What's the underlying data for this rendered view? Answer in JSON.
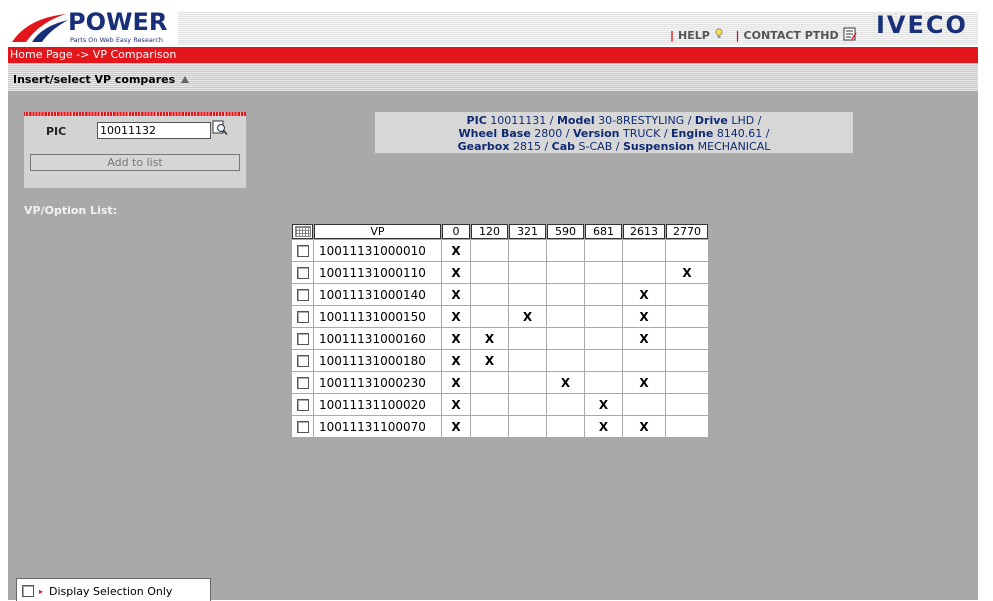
{
  "header": {
    "brand": "POWER",
    "tagline": "Parts On Web Easy Research",
    "help_label": "HELP",
    "contact_label": "CONTACT PTHD",
    "partner_logo": "IVECO",
    "accent_red": "#e3161c",
    "brand_blue": "#1a2f7a"
  },
  "breadcrumb": "Home Page -> VP Comparison",
  "section_title": "Insert/select VP compares",
  "pic_form": {
    "label": "PIC",
    "value": "10011132",
    "search_icon": "search-doc-icon",
    "add_button": "Add to list"
  },
  "info": {
    "pic_label": "PIC",
    "pic": "10011131",
    "model_label": "Model",
    "model": "30-8RESTYLING",
    "drive_label": "Drive",
    "drive": "LHD",
    "wheelbase_label": "Wheel Base",
    "wheelbase": "2800",
    "version_label": "Version",
    "version": "TRUCK",
    "engine_label": "Engine",
    "engine": "8140.61",
    "gearbox_label": "Gearbox",
    "gearbox": "2815",
    "cab_label": "Cab",
    "cab": "S-CAB",
    "suspension_label": "Suspension",
    "suspension": "MECHANICAL"
  },
  "vp_list_label": "VP/Option List:",
  "table": {
    "header_vp": "VP",
    "columns": [
      "0",
      "120",
      "321",
      "590",
      "681",
      "2613",
      "2770"
    ],
    "mark": "X",
    "rows": [
      {
        "vp": "10011131000010",
        "marks": [
          "X",
          "",
          "",
          "",
          "",
          "",
          ""
        ]
      },
      {
        "vp": "10011131000110",
        "marks": [
          "X",
          "",
          "",
          "",
          "",
          "",
          "X"
        ]
      },
      {
        "vp": "10011131000140",
        "marks": [
          "X",
          "",
          "",
          "",
          "",
          "X",
          ""
        ]
      },
      {
        "vp": "10011131000150",
        "marks": [
          "X",
          "",
          "X",
          "",
          "",
          "X",
          ""
        ]
      },
      {
        "vp": "10011131000160",
        "marks": [
          "X",
          "X",
          "",
          "",
          "",
          "X",
          ""
        ]
      },
      {
        "vp": "10011131000180",
        "marks": [
          "X",
          "X",
          "",
          "",
          "",
          "",
          ""
        ]
      },
      {
        "vp": "10011131000230",
        "marks": [
          "X",
          "",
          "",
          "X",
          "",
          "X",
          ""
        ]
      },
      {
        "vp": "10011131100020",
        "marks": [
          "X",
          "",
          "",
          "",
          "X",
          "",
          ""
        ]
      },
      {
        "vp": "10011131100070",
        "marks": [
          "X",
          "",
          "",
          "",
          "X",
          "X",
          ""
        ]
      }
    ]
  },
  "display_selection": "Display Selection Only"
}
